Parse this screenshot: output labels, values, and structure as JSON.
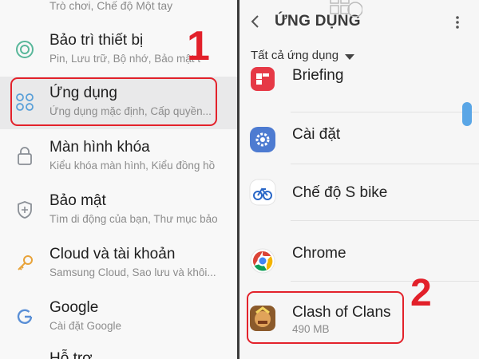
{
  "left": {
    "top_partial": "Trò chơi, Chế độ Một tay",
    "items": [
      {
        "title": "Bảo trì thiết bị",
        "subtitle": "Pin, Lưu trữ, Bộ nhớ, Bảo mật t",
        "icon": "device-maintenance-icon"
      },
      {
        "title": "Ứng dụng",
        "subtitle": "Ứng dụng mặc định, Cấp quyền...",
        "icon": "apps-icon"
      },
      {
        "title": "Màn hình khóa",
        "subtitle": "Kiểu khóa màn hình, Kiểu đồng hồ",
        "icon": "lock-icon"
      },
      {
        "title": "Bảo mật",
        "subtitle": "Tìm di động của bạn, Thư mục bảo",
        "icon": "shield-icon"
      },
      {
        "title": "Cloud và tài khoản",
        "subtitle": "Samsung Cloud, Sao lưu và khôi...",
        "icon": "key-icon"
      },
      {
        "title": "Google",
        "subtitle": "Cài đặt Google",
        "icon": "google-icon"
      }
    ],
    "bottom_partial": "Hỗ trợ",
    "step_label": "1"
  },
  "right": {
    "title": "ỨNG DỤNG",
    "filter_label": "Tất cả ứng dụng",
    "apps": [
      {
        "name": "Briefing",
        "icon": "briefing-icon"
      },
      {
        "name": "Cài đặt",
        "icon": "settings-gear-icon"
      },
      {
        "name": "Chế độ S bike",
        "icon": "s-bike-icon"
      },
      {
        "name": "Chrome",
        "icon": "chrome-icon"
      },
      {
        "name": "Clash of Clans",
        "size": "490 MB",
        "icon": "clash-of-clans-icon"
      }
    ],
    "step_label": "2"
  },
  "colors": {
    "highlight": "#e3222b",
    "accent": "#5aa6e6",
    "divider": "#3a3a3a"
  }
}
